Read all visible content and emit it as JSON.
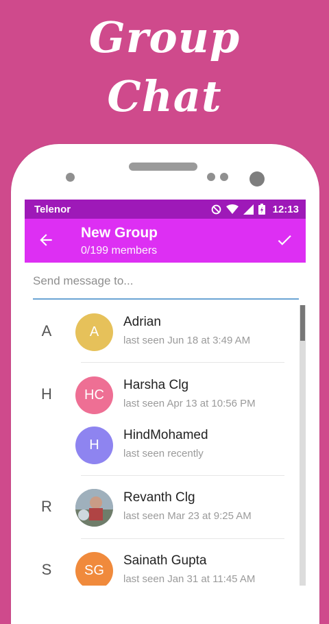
{
  "promo": {
    "line1": "Group",
    "line2": "Chat"
  },
  "status_bar": {
    "carrier": "Telenor",
    "time": "12:13"
  },
  "app_bar": {
    "title": "New Group",
    "subtitle": "0/199 members"
  },
  "search": {
    "placeholder": "Send message to..."
  },
  "contacts": [
    {
      "section": "A",
      "initials": "A",
      "name": "Adrian",
      "status": "last seen Jun 18 at 3:49 AM",
      "avatar_color": "#e6c15a"
    },
    {
      "section": "H",
      "initials": "HC",
      "name": "Harsha Clg",
      "status": "last seen Apr 13 at 10:56 PM",
      "avatar_color": "#ee6f94"
    },
    {
      "section": "",
      "initials": "H",
      "name": "HindMohamed",
      "status": "last seen recently",
      "avatar_color": "#8e84f0"
    },
    {
      "section": "R",
      "initials": "",
      "name": "Revanth Clg",
      "status": "last seen Mar 23 at 9:25 AM",
      "avatar_color": "#8a9aa6"
    },
    {
      "section": "S",
      "initials": "SG",
      "name": "Sainath Gupta",
      "status": "last seen Jan 31 at 11:45 AM",
      "avatar_color": "#f08a3c"
    }
  ]
}
